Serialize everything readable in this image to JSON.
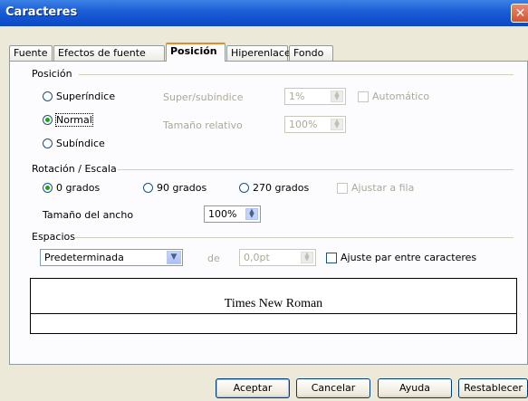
{
  "window": {
    "title": "Caracteres"
  },
  "tabs": [
    {
      "label": "Fuente"
    },
    {
      "label": "Efectos de fuente"
    },
    {
      "label": "Posición"
    },
    {
      "label": "Hiperenlace"
    },
    {
      "label": "Fondo"
    }
  ],
  "posicion": {
    "heading": "Posición",
    "superindice": "Superíndice",
    "normal": "Normal",
    "subindice": "Subíndice",
    "super_sub_label": "Super/subíndice",
    "super_sub_value": "1%",
    "automatico": "Automático",
    "tamano_relativo_label": "Tamaño relativo",
    "tamano_relativo_value": "100%"
  },
  "rotacion": {
    "heading": "Rotación / Escala",
    "g0": "0 grados",
    "g90": "90 grados",
    "g270": "270 grados",
    "ajustar": "Ajustar a fila",
    "ancho_label": "Tamaño del ancho",
    "ancho_value": "100%"
  },
  "espacios": {
    "heading": "Espacios",
    "mode": "Predeterminada",
    "de": "de",
    "value": "0,0pt",
    "ajuste": "Ajuste par entre caracteres"
  },
  "preview": {
    "text": "Times New Roman"
  },
  "buttons": {
    "aceptar": "Aceptar",
    "cancelar": "Cancelar",
    "ayuda": "Ayuda",
    "restablecer": "Restablecer"
  }
}
